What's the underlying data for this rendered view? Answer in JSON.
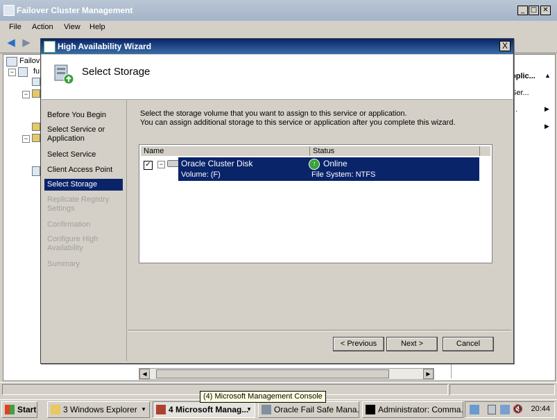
{
  "main_window": {
    "title": "Failover Cluster Management",
    "menu": [
      "File",
      "Action",
      "View",
      "Help"
    ],
    "tree": [
      "Failov",
      "fu"
    ],
    "actions_pane": {
      "heading": "pplic...",
      "items": [
        "Ser...",
        "..."
      ]
    }
  },
  "dialog": {
    "title": "High Availability Wizard",
    "close_glyph": "X",
    "header_title": "Select Storage",
    "steps": [
      {
        "label": "Before You Begin",
        "state": "enabled"
      },
      {
        "label": "Select Service or Application",
        "state": "enabled"
      },
      {
        "label": "Select Service",
        "state": "enabled"
      },
      {
        "label": "Client Access Point",
        "state": "enabled"
      },
      {
        "label": "Select Storage",
        "state": "active"
      },
      {
        "label": "Replicate Registry Settings",
        "state": "disabled"
      },
      {
        "label": "Confirmation",
        "state": "disabled"
      },
      {
        "label": "Configure High Availability",
        "state": "disabled"
      },
      {
        "label": "Summary",
        "state": "disabled"
      }
    ],
    "instruction_line1": "Select the storage volume that you want to assign to this service or application.",
    "instruction_line2": "You can assign additional storage to this service or application after you complete this wizard.",
    "table": {
      "columns": [
        "Name",
        "Status"
      ],
      "rows": [
        {
          "checked": true,
          "name": "Oracle Cluster Disk",
          "status": "Online",
          "sub_name": "Volume: (F)",
          "sub_status": "File System: NTFS"
        }
      ]
    },
    "buttons": {
      "previous": "< Previous",
      "next": "Next >",
      "cancel": "Cancel"
    }
  },
  "taskbar": {
    "start": "Start",
    "tasks": [
      {
        "label": "3 Windows Explorer",
        "active": false
      },
      {
        "label": "4 Microsoft Manag...",
        "active": true
      },
      {
        "label": "Oracle Fail Safe Mana...",
        "active": false
      },
      {
        "label": "Administrator: Comma...",
        "active": false
      }
    ],
    "tooltip": "(4) Microsoft Management Console",
    "clock": "20:44"
  },
  "colors": {
    "selection": "#0a246a",
    "window_face": "#d4d0c8",
    "online_green": "#3ca03c"
  }
}
